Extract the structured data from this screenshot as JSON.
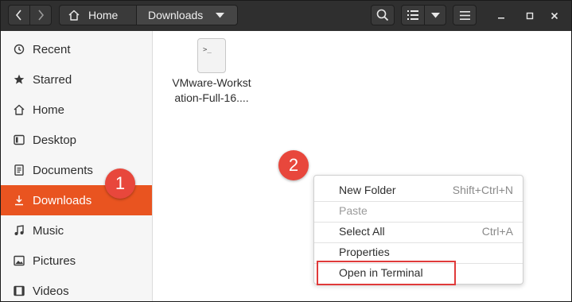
{
  "header": {
    "path": [
      "Home",
      "Downloads"
    ],
    "icons": [
      "chevron-left",
      "chevron-right",
      "home",
      "chevron-down",
      "search",
      "list-view",
      "chevron-down",
      "hamburger-menu",
      "minimize",
      "maximize",
      "close"
    ]
  },
  "sidebar": {
    "items": [
      {
        "label": "Recent",
        "icon": "clock"
      },
      {
        "label": "Starred",
        "icon": "star"
      },
      {
        "label": "Home",
        "icon": "home"
      },
      {
        "label": "Desktop",
        "icon": "desktop"
      },
      {
        "label": "Documents",
        "icon": "document"
      },
      {
        "label": "Downloads",
        "icon": "download"
      },
      {
        "label": "Music",
        "icon": "music"
      },
      {
        "label": "Pictures",
        "icon": "picture"
      },
      {
        "label": "Videos",
        "icon": "video"
      }
    ],
    "active_index": 5
  },
  "files": [
    {
      "name": "VMware-Workstation-Full-16....",
      "icon": "terminal-script"
    }
  ],
  "context_menu": {
    "items": [
      {
        "label": "New Folder",
        "shortcut": "Shift+Ctrl+N",
        "enabled": true
      },
      {
        "label": "Paste",
        "shortcut": "",
        "enabled": false
      },
      {
        "label": "Select All",
        "shortcut": "Ctrl+A",
        "enabled": true
      },
      {
        "label": "Properties",
        "shortcut": "",
        "enabled": true
      },
      {
        "label": "Open in Terminal",
        "shortcut": "",
        "enabled": true,
        "highlighted": true
      }
    ]
  },
  "step_markers": [
    "1",
    "2"
  ],
  "colors": {
    "accent": "#e95420",
    "marker": "#e8473c",
    "highlight_border": "#e03a3a",
    "headerbar": "#2f2f2f"
  }
}
